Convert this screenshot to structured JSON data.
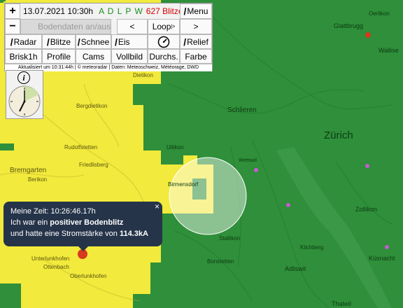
{
  "header": {
    "zoom_in_label": "+",
    "zoom_out_label": "−",
    "datetime": "13.07.2021 10:30h",
    "station_letters": "A D L P W",
    "lightning_count": "627 Blitze",
    "menu_label": "Menu",
    "ground_data_label": "Bodendaten an/aus",
    "prev_label": "<",
    "loop_label": "Loop",
    "loop_mark": "|>",
    "next_label": ">"
  },
  "toggles": {
    "radar": "Radar",
    "blitze": "Blitze",
    "schnee": "Schnee",
    "eis": "Eis",
    "relief": "Relief"
  },
  "buttons": {
    "brisk": "Brisk1h",
    "profile": "Profile",
    "cams": "Cams",
    "vollbild": "Vollbild",
    "durchs": "Durchs.",
    "farbe": "Farbe"
  },
  "status_line": "Aktualisiert um 10:31:44h | © meteoradar | Daten: Meteoschweiz, Météorage, DWD",
  "info_icon_label": "i",
  "popup": {
    "time_line": "Meine Zeit: 10:26:46.17h",
    "line2_prefix": "Ich war ein",
    "line2_bold": "positiver Bodenblitz",
    "line3_prefix": "und hatte eine Stromstärke von",
    "line3_bold": "114.3kA",
    "close_label": "×"
  },
  "map_labels": {
    "zurich": "Zürich",
    "glattbrugg": "Glattbrugg",
    "wallisellen": "Wallise",
    "schlieren": "Schlieren",
    "uitikon": "Uitikon",
    "birmensdorf": "Birmensdorf",
    "bremgarten": "Bremgarten",
    "zollikon": "Zollikon",
    "kusnacht": "Küsnacht",
    "adliswil": "Adliswil",
    "thalwil": "Thalwil",
    "kilchberg": "Kilchberg",
    "stallikon": "Stallikon",
    "bonstetten": "Bonstetten",
    "oberlunkhofen": "Oberlunkhofen",
    "berikon": "Berikon",
    "rudolfstetten": "Rudolfstetten",
    "bergdietikon": "Bergdietikon",
    "friedlisberg": "Friedlisberg",
    "ottenbach": "Ottenbach",
    "unterlunkhofen": "Unterlunkhofen",
    "dietikon": "Dietikon",
    "wettswil": "Wettswil",
    "oerlikon": "Oerlikon"
  },
  "colors": {
    "rain_green": "#2f8f3a",
    "rain_yellow": "#f2ea3c",
    "lightning_red": "#d63a1e",
    "popup_bg": "#26344a",
    "lightning_count_red": "#d40000",
    "station_green": "#1a8f1a"
  }
}
